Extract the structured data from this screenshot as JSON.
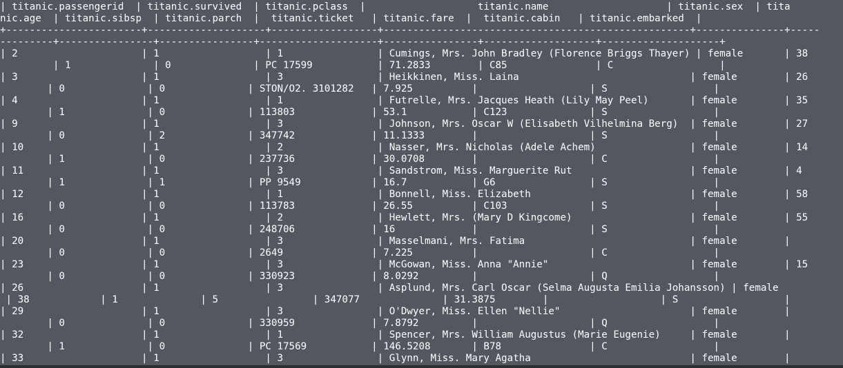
{
  "terminal": {
    "lines": [
      "| titanic.passengerid  | titanic.survived  | titanic.pclass  |                   titanic.name                    | titanic.sex  | tita",
      "nic.age  | titanic.sibsp  | titanic.parch  |  titanic.ticket   | titanic.fare  |  titanic.cabin   | titanic.embarked  |",
      "+-----------------------+--------------------+------------------+----------------------------------------------------+---------------+-----",
      "---------+----------------+----------------+--------------------+----------------+-------------------+--------------------+",
      "| 2                     | 1                  | 1                | Cumings, Mrs. John Bradley (Florence Briggs Thayer) | female       | 38",
      "         | 1              | 0              | PC 17599           | 71.2833        | C85               | C                  |",
      "| 3                     | 1                  | 3                | Heikkinen, Miss. Laina                             | female        | 26",
      "        | 0              | 0              | STON/O2. 3101282   | 7.925          |                   | S                  |",
      "| 4                     | 1                  | 1                | Futrelle, Mrs. Jacques Heath (Lily May Peel)       | female        | 35",
      "        | 1              | 0              | 113803             | 53.1           | C123              | S                  |",
      "| 9                     | 1                  | 3                | Johnson, Mrs. Oscar W (Elisabeth Vilhelmina Berg)  | female        | 27",
      "        | 0              | 2              | 347742             | 11.1333        |                   | S                  |",
      "| 10                    | 1                  | 2                | Nasser, Mrs. Nicholas (Adele Achem)                | female        | 14",
      "        | 1              | 0              | 237736             | 30.0708        |                   | C                  |",
      "| 11                    | 1                  | 3                | Sandstrom, Miss. Marguerite Rut                    | female        | 4",
      "        | 1              | 1              | PP 9549            | 16.7           | G6                | S                  |",
      "| 12                    | 1                  | 1                | Bonnell, Miss. Elizabeth                           | female        | 58",
      "        | 0              | 0              | 113783             | 26.55          | C103              | S                  |",
      "| 16                    | 1                  | 2                | Hewlett, Mrs. (Mary D Kingcome)                    | female        | 55",
      "        | 0              | 0              | 248706             | 16             |                   | S                  |",
      "| 20                    | 1                  | 3                | Masselmani, Mrs. Fatima                            | female        |",
      "        | 0              | 0              | 2649               | 7.225          |                   | C                  |",
      "| 23                    | 1                  | 3                | McGowan, Miss. Anna \"Annie\"                        | female        | 15",
      "        | 0              | 0              | 330923             | 8.0292         |                   | Q                  |",
      "| 26                    | 1                  | 3                | Asplund, Mrs. Carl Oscar (Selma Augusta Emilia Johansson) | female",
      " | 38            | 1              | 5                | 347077              | 31.3875        |                   | S                  |",
      "| 29                    | 1                  | 3                | O'Dwyer, Miss. Ellen \"Nellie\"                      | female        |",
      "        | 0              | 0              | 330959             | 7.8792         |                   | Q                  |",
      "| 32                    | 1                  | 1                | Spencer, Mrs. William Augustus (Marie Eugenie)     | female        |",
      "        | 1              | 0              | PC 17569           | 146.5208       | B78               | C                  |",
      "| 33                    | 1                  | 3                | Glynn, Miss. Mary Agatha                           | female        |"
    ]
  }
}
